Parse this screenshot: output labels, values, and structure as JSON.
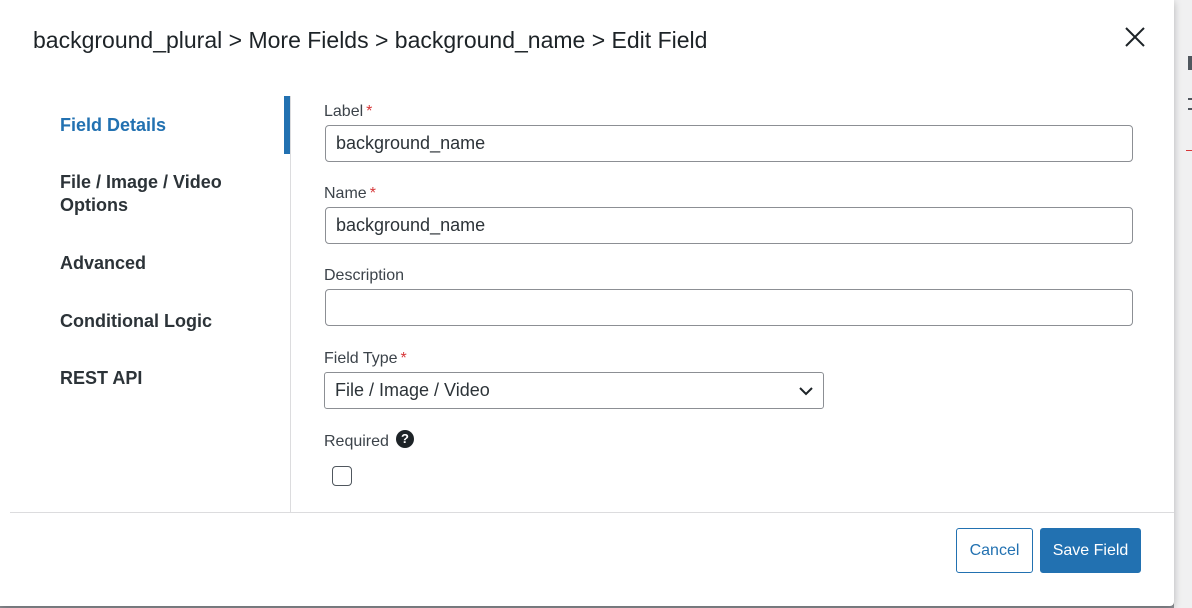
{
  "header": {
    "breadcrumb": "background_plural > More Fields > background_name > Edit Field"
  },
  "nav": {
    "items": [
      {
        "label": "Field Details"
      },
      {
        "label": "File / Image / Video Options"
      },
      {
        "label": "Advanced"
      },
      {
        "label": "Conditional Logic"
      },
      {
        "label": "REST API"
      }
    ],
    "active": "Field Details"
  },
  "form": {
    "label": {
      "label": "Label",
      "required_mark": "*",
      "value": "background_name"
    },
    "name": {
      "label": "Name",
      "required_mark": "*",
      "value": "background_name"
    },
    "description": {
      "label": "Description",
      "value": ""
    },
    "field_type": {
      "label": "Field Type",
      "required_mark": "*",
      "selected": "File / Image / Video"
    },
    "required": {
      "label": "Required",
      "help_icon": "question-circle-icon",
      "help_glyph": "?",
      "checked": false
    }
  },
  "footer": {
    "cancel_label": "Cancel",
    "save_label": "Save Field"
  },
  "colors": {
    "accent": "#2271b1",
    "required": "#d63638",
    "text": "#1d2327"
  }
}
